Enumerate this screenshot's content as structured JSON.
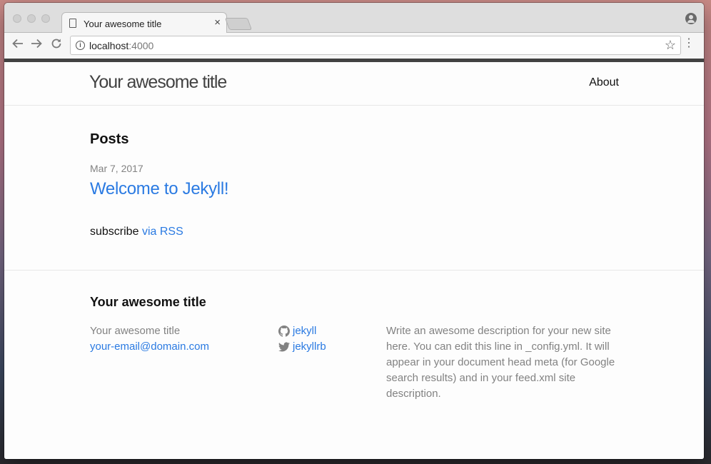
{
  "browser": {
    "tab_title": "Your awesome title",
    "tab_close": "×",
    "url_host": "localhost",
    "url_port": ":4000"
  },
  "icons": {
    "back": "arrow-left-icon",
    "forward": "arrow-right-icon",
    "reload": "reload-icon",
    "info": "info-icon",
    "bookmark": "star-icon",
    "menu": "kebab-menu-icon",
    "profile": "profile-icon",
    "github": "github-icon",
    "twitter": "twitter-icon"
  },
  "site": {
    "title": "Your awesome title",
    "nav": {
      "about": "About"
    }
  },
  "main": {
    "posts_heading": "Posts",
    "posts": [
      {
        "date": "Mar 7, 2017",
        "title": "Welcome to Jekyll!"
      }
    ],
    "subscribe_text": "subscribe",
    "rss_link": "via RSS"
  },
  "footer": {
    "heading": "Your awesome title",
    "site_name": "Your awesome title",
    "email": "your-email@domain.com",
    "github_user": "jekyll",
    "twitter_user": "jekyllrb",
    "description": "Write an awesome description for your new site here. You can edit this line in _config.yml. It will appear in your document head meta (for Google search results) and in your feed.xml site description."
  },
  "colors": {
    "link": "#2a7ae2",
    "muted": "#828282",
    "header_bar": "#424242"
  }
}
